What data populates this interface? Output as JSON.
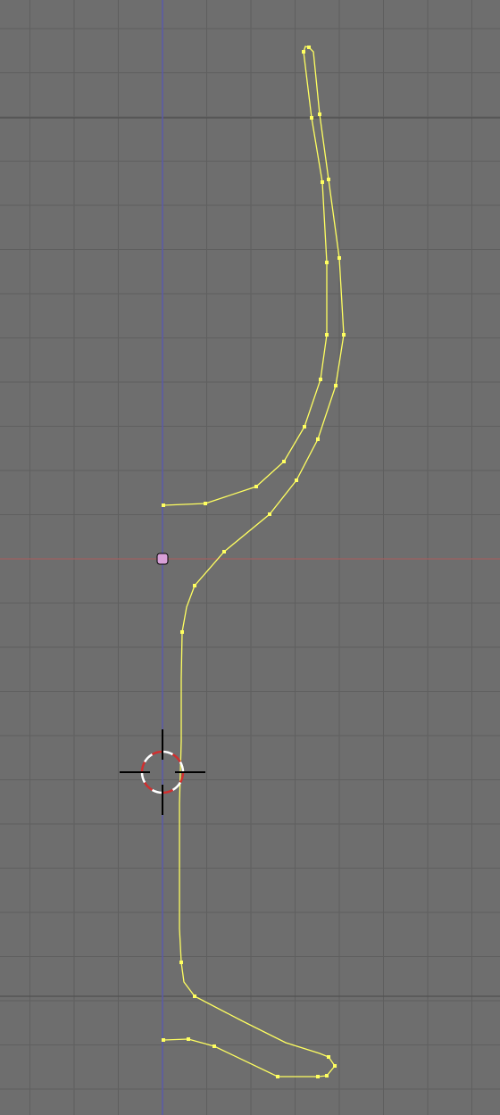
{
  "viewport": {
    "view": "3d-viewport-edit-mode",
    "background_color": "#6e6e6e",
    "grid_color": "#5f5f5f",
    "grid_major_color": "#505050",
    "x_axis_color": "#a06060",
    "z_axis_color": "#5a5aa8"
  },
  "profile_curve": {
    "color": "#ffff60",
    "vertex_color": "#ffff60"
  },
  "object_origin": {
    "color": "#d8a0d8"
  },
  "cursor_3d": {
    "ring_colors": [
      "#d03030",
      "#ffffff"
    ],
    "crosshair_color": "#000000"
  }
}
